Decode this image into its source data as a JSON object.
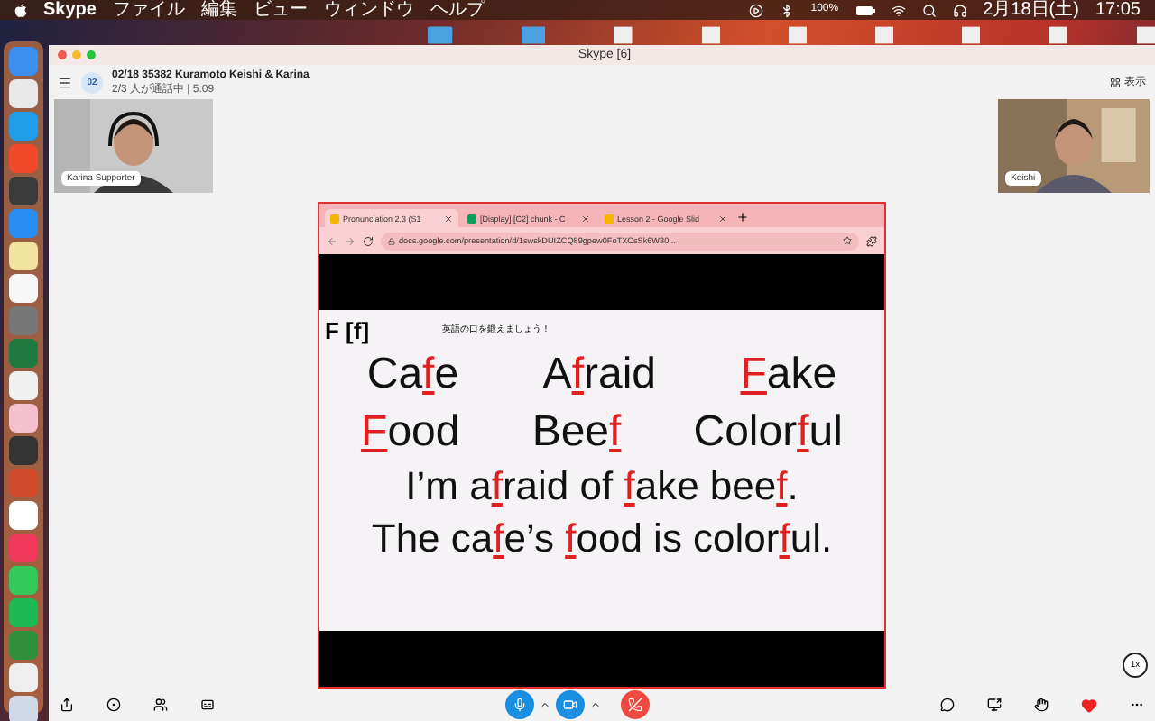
{
  "menu_bar": {
    "app": "Skype",
    "menus": [
      "ファイル",
      "編集",
      "ビュー",
      "ウィンドウ",
      "ヘルプ"
    ],
    "battery": "100%",
    "date": "2月18日(土)",
    "time": "17:05"
  },
  "window": {
    "title": "Skype [6]"
  },
  "conversation": {
    "avatar": "02",
    "title": "02/18 35382 Kuramoto Keishi & Karina",
    "subtitle": "2/3 人が通話中 | 5:09",
    "view_button": "表示"
  },
  "participants": [
    {
      "name": "Karina Supporter",
      "kind": "headset"
    },
    {
      "name": "Keishi",
      "kind": "plain"
    }
  ],
  "browser": {
    "tabs": [
      {
        "label": "Pronunciation 2.3 (S1",
        "selected": true
      },
      {
        "label": "[Display] [C2] chunk - C",
        "selected": false
      },
      {
        "label": "Lesson 2 - Google Slid",
        "selected": false
      }
    ],
    "url": "docs.google.com/presentation/d/1swskDUIZCQ89gpew0FoTXCsSk6W30..."
  },
  "slide": {
    "heading": "F [f]",
    "instruction": "英語の口を鍛えましょう！",
    "lines": [
      {
        "kind": "words",
        "items": [
          [
            {
              "text": "Ca",
              "highlight": false
            },
            {
              "text": "f",
              "highlight": true
            },
            {
              "text": "e",
              "highlight": false
            }
          ],
          [
            {
              "text": "A",
              "highlight": false
            },
            {
              "text": "f",
              "highlight": true
            },
            {
              "text": "raid",
              "highlight": false
            }
          ],
          [
            {
              "text": "F",
              "highlight": true
            },
            {
              "text": "ake",
              "highlight": false
            }
          ]
        ]
      },
      {
        "kind": "words",
        "items": [
          [
            {
              "text": "F",
              "highlight": true
            },
            {
              "text": "ood",
              "highlight": false
            }
          ],
          [
            {
              "text": "Bee",
              "highlight": false
            },
            {
              "text": "f",
              "highlight": true
            }
          ],
          [
            {
              "text": "Color",
              "highlight": false
            },
            {
              "text": "f",
              "highlight": true
            },
            {
              "text": "ul",
              "highlight": false
            }
          ]
        ]
      },
      {
        "kind": "sentence",
        "parts": [
          {
            "text": "I’m a",
            "highlight": false
          },
          {
            "text": "f",
            "highlight": true
          },
          {
            "text": "raid of ",
            "highlight": false
          },
          {
            "text": "f",
            "highlight": true
          },
          {
            "text": "ake bee",
            "highlight": false
          },
          {
            "text": "f",
            "highlight": true
          },
          {
            "text": ".",
            "highlight": false
          }
        ]
      },
      {
        "kind": "sentence",
        "parts": [
          {
            "text": "The ca",
            "highlight": false
          },
          {
            "text": "f",
            "highlight": true
          },
          {
            "text": "e’s ",
            "highlight": false
          },
          {
            "text": "f",
            "highlight": true
          },
          {
            "text": "ood is color",
            "highlight": false
          },
          {
            "text": "f",
            "highlight": true
          },
          {
            "text": "ul.",
            "highlight": false
          }
        ]
      }
    ]
  },
  "playback_speed": "1x"
}
